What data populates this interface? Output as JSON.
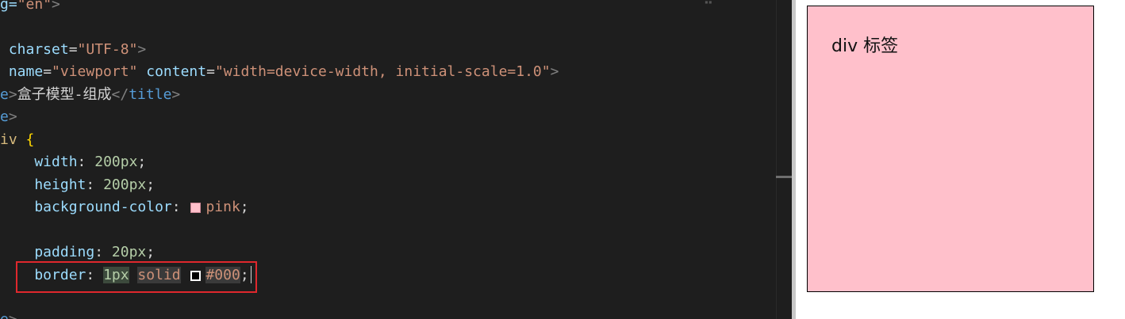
{
  "editor": {
    "line1": {
      "a": "g=",
      "b": "\"en\"",
      "c": ">"
    },
    "line3": {
      "a": " charset",
      "b": "=",
      "c": "\"UTF-8\"",
      "d": ">"
    },
    "line4": {
      "a": " name",
      "b": "=",
      "c": "\"viewport\"",
      "d": " content",
      "e": "=",
      "f": "\"width=device-width, initial-scale=1.0\"",
      "g": ">"
    },
    "line5": {
      "a": "e",
      "b": ">",
      "c": "盒子模型-组成",
      "d": "</",
      "e": "title",
      "f": ">"
    },
    "line6": {
      "a": "e",
      "b": ">"
    },
    "line7": {
      "a": "iv",
      "b": " {"
    },
    "line8": {
      "a": "    width",
      "b": ": ",
      "c": "200px",
      "d": ";"
    },
    "line9": {
      "a": "    height",
      "b": ": ",
      "c": "200px",
      "d": ";"
    },
    "line10": {
      "a": "    background-color",
      "b": ": ",
      "c": "pink",
      "d": ";"
    },
    "line12": {
      "a": "    padding",
      "b": ": ",
      "c": "20px",
      "d": ";"
    },
    "line13": {
      "a": "    border",
      "b": ": ",
      "c": "1px",
      "d": " ",
      "e": "solid",
      "f": " ",
      "g": "#000",
      "h": ";"
    },
    "line15": {
      "a": "e",
      "b": ">"
    }
  },
  "colors": {
    "pink_swatch": "#ffc0cb",
    "black_swatch": "#000000",
    "highlight_border": "#e0282d"
  },
  "preview": {
    "div_text": "div 标签"
  }
}
